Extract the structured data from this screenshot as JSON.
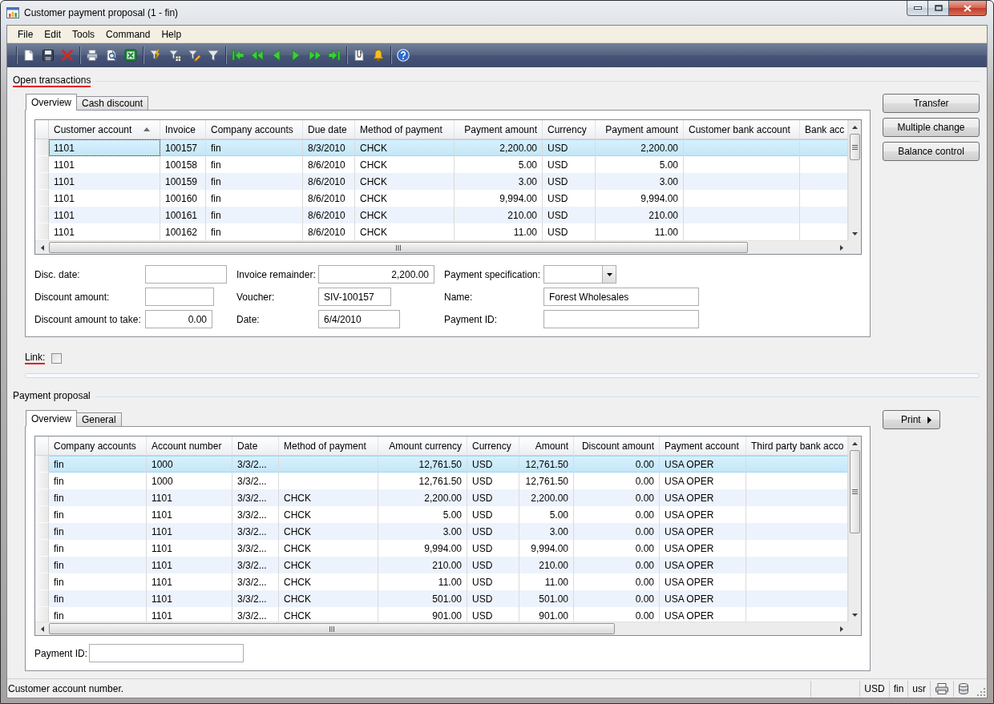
{
  "window": {
    "title": "Customer payment proposal (1 - fin)"
  },
  "menu": [
    {
      "label": "File"
    },
    {
      "label": "Edit"
    },
    {
      "label": "Tools"
    },
    {
      "label": "Command"
    },
    {
      "label": "Help"
    }
  ],
  "open_transactions": {
    "title": "Open transactions",
    "underlined": true,
    "tabs": [
      {
        "label": "Overview",
        "selected": true
      },
      {
        "label": "Cash discount",
        "selected": false
      }
    ],
    "table": {
      "focused": true,
      "columns": [
        {
          "label": "Customer account",
          "kind": "text",
          "sorted": true
        },
        {
          "label": "Invoice",
          "kind": "text",
          "sorted": false
        },
        {
          "label": "Company accounts",
          "kind": "text",
          "sorted": false
        },
        {
          "label": "Due date",
          "kind": "text",
          "sorted": false
        },
        {
          "label": "Method of payment",
          "kind": "text",
          "sorted": false
        },
        {
          "label": "Payment amount",
          "kind": "amount",
          "sorted": false
        },
        {
          "label": "Currency",
          "kind": "text",
          "sorted": false
        },
        {
          "label": "Payment amount",
          "kind": "amount",
          "sorted": false
        },
        {
          "label": "Customer bank account",
          "kind": "text",
          "sorted": false
        },
        {
          "label": "Bank acc",
          "kind": "text",
          "sorted": false
        }
      ],
      "rows": [
        {
          "selected": true,
          "cells": [
            "1101",
            "100157",
            "fin",
            "8/3/2010",
            "CHCK",
            "2,200.00",
            "USD",
            "2,200.00"
          ]
        },
        {
          "selected": false,
          "cells": [
            "1101",
            "100158",
            "fin",
            "8/6/2010",
            "CHCK",
            "5.00",
            "USD",
            "5.00"
          ]
        },
        {
          "selected": false,
          "cells": [
            "1101",
            "100159",
            "fin",
            "8/6/2010",
            "CHCK",
            "3.00",
            "USD",
            "3.00"
          ]
        },
        {
          "selected": false,
          "cells": [
            "1101",
            "100160",
            "fin",
            "8/6/2010",
            "CHCK",
            "9,994.00",
            "USD",
            "9,994.00"
          ]
        },
        {
          "selected": false,
          "cells": [
            "1101",
            "100161",
            "fin",
            "8/6/2010",
            "CHCK",
            "210.00",
            "USD",
            "210.00"
          ]
        },
        {
          "selected": false,
          "cells": [
            "1101",
            "100162",
            "fin",
            "8/6/2010",
            "CHCK",
            "11.00",
            "USD",
            "11.00"
          ]
        }
      ]
    },
    "fields": [
      [
        {
          "label": "Disc. date:",
          "kind": "text"
        },
        {
          "label": "Discount amount:",
          "kind": "text"
        },
        {
          "label": "Discount amount to take:",
          "kind": "amount",
          "value": "0.00"
        }
      ],
      [
        {
          "label": "Invoice remainder:",
          "kind": "amount",
          "value": "2,200.00"
        },
        {
          "label": "Voucher:",
          "kind": "text",
          "value": "SIV-100157"
        },
        {
          "label": "Date:",
          "kind": "text",
          "value": "6/4/2010"
        }
      ],
      [
        {
          "label": "Payment specification:",
          "kind": "combo"
        },
        {
          "label": "Name:",
          "kind": "text",
          "value": "Forest Wholesales"
        },
        {
          "label": "Payment ID:",
          "kind": "text"
        }
      ]
    ],
    "buttons": [
      {
        "label": "Transfer",
        "kind": "plain"
      },
      {
        "label": "Multiple change",
        "kind": "plain"
      },
      {
        "label": "Balance control",
        "kind": "plain"
      }
    ]
  },
  "link": {
    "label": "Link:",
    "underlined": true,
    "checked": false
  },
  "payment_proposal": {
    "title": "Payment proposal",
    "underlined": false,
    "tabs": [
      {
        "label": "Overview",
        "selected": true
      },
      {
        "label": "General",
        "selected": false
      }
    ],
    "table": {
      "focused": false,
      "columns": [
        {
          "label": "Company accounts",
          "kind": "text",
          "sorted": false
        },
        {
          "label": "Account number",
          "kind": "text",
          "sorted": false
        },
        {
          "label": "Date",
          "kind": "text",
          "sorted": false
        },
        {
          "label": "Method of payment",
          "kind": "text",
          "sorted": false
        },
        {
          "label": "Amount currency",
          "kind": "amount",
          "sorted": false
        },
        {
          "label": "Currency",
          "kind": "text",
          "sorted": false
        },
        {
          "label": "Amount",
          "kind": "amount",
          "sorted": false
        },
        {
          "label": "Discount amount",
          "kind": "amount",
          "sorted": false
        },
        {
          "label": "Payment account",
          "kind": "text",
          "sorted": false
        },
        {
          "label": "Third party bank acco",
          "kind": "text",
          "sorted": false
        }
      ],
      "rows": [
        {
          "selected": true,
          "cells": [
            "fin",
            "1000",
            "3/3/2...",
            null,
            "12,761.50",
            "USD",
            "12,761.50",
            "0.00",
            "USA OPER"
          ]
        },
        {
          "selected": false,
          "cells": [
            "fin",
            "1000",
            "3/3/2...",
            null,
            "12,761.50",
            "USD",
            "12,761.50",
            "0.00",
            "USA OPER"
          ]
        },
        {
          "selected": false,
          "cells": [
            "fin",
            "1101",
            "3/3/2...",
            "CHCK",
            "2,200.00",
            "USD",
            "2,200.00",
            "0.00",
            "USA OPER"
          ]
        },
        {
          "selected": false,
          "cells": [
            "fin",
            "1101",
            "3/3/2...",
            "CHCK",
            "5.00",
            "USD",
            "5.00",
            "0.00",
            "USA OPER"
          ]
        },
        {
          "selected": false,
          "cells": [
            "fin",
            "1101",
            "3/3/2...",
            "CHCK",
            "3.00",
            "USD",
            "3.00",
            "0.00",
            "USA OPER"
          ]
        },
        {
          "selected": false,
          "cells": [
            "fin",
            "1101",
            "3/3/2...",
            "CHCK",
            "9,994.00",
            "USD",
            "9,994.00",
            "0.00",
            "USA OPER"
          ]
        },
        {
          "selected": false,
          "cells": [
            "fin",
            "1101",
            "3/3/2...",
            "CHCK",
            "210.00",
            "USD",
            "210.00",
            "0.00",
            "USA OPER"
          ]
        },
        {
          "selected": false,
          "cells": [
            "fin",
            "1101",
            "3/3/2...",
            "CHCK",
            "11.00",
            "USD",
            "11.00",
            "0.00",
            "USA OPER"
          ]
        },
        {
          "selected": false,
          "cells": [
            "fin",
            "1101",
            "3/3/2...",
            "CHCK",
            "501.00",
            "USD",
            "501.00",
            "0.00",
            "USA OPER"
          ]
        },
        {
          "selected": false,
          "cells": [
            "fin",
            "1101",
            "3/3/2...",
            "CHCK",
            "901.00",
            "USD",
            "901.00",
            "0.00",
            "USA OPER"
          ]
        }
      ]
    },
    "fields": [
      [
        {
          "label": "Payment ID:",
          "kind": "text"
        }
      ]
    ],
    "buttons": [
      {
        "label": "Print",
        "kind": "menu"
      }
    ]
  },
  "status_bar": {
    "message": "Customer account number.",
    "panels": [
      {
        "label": "USD"
      },
      {
        "label": "fin"
      },
      {
        "label": "usr"
      }
    ]
  }
}
